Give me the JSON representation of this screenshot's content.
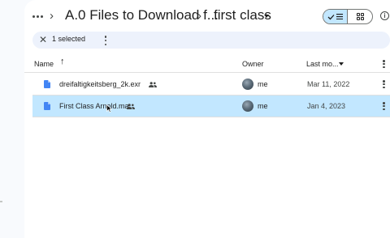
{
  "breadcrumb": {
    "parent_folder": "A.0 Files to Download f...",
    "current_folder": "first class"
  },
  "selection_bar": {
    "count_label": "1 selected"
  },
  "columns": {
    "name": "Name",
    "owner": "Owner",
    "modified": "Last mo..."
  },
  "files": [
    {
      "name": "dreifaltigkeitsberg_2k.exr",
      "owner": "me",
      "modified": "Mar 11, 2022",
      "shared": true,
      "selected": false
    },
    {
      "name": "First Class Arnold.ma",
      "owner": "me",
      "modified": "Jan 4, 2023",
      "shared": true,
      "selected": true
    }
  ],
  "colors": {
    "accent": "#c2e7ff",
    "file_icon": "#4285f4",
    "selection_bar": "#edf2fc"
  },
  "icons": {
    "more": "more-horiz-icon",
    "separator": "chevron-right-icon",
    "view_list": "check-list-icon",
    "view_grid": "grid-icon",
    "info": "info-icon",
    "close": "close-icon",
    "sort": "arrow-up-icon",
    "file": "doc-file-icon",
    "shared": "people-icon"
  }
}
